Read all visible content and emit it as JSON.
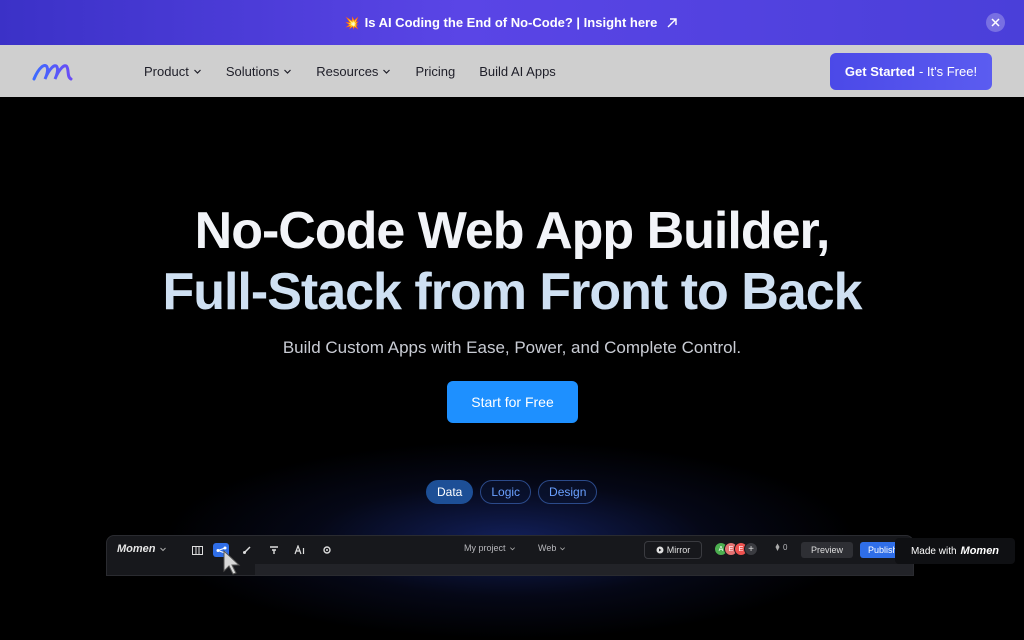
{
  "banner": {
    "emoji": "💥",
    "text": "Is AI Coding the End of No-Code? | Insight here"
  },
  "nav": {
    "items": [
      {
        "label": "Product",
        "dropdown": true
      },
      {
        "label": "Solutions",
        "dropdown": true
      },
      {
        "label": "Resources",
        "dropdown": true
      },
      {
        "label": "Pricing",
        "dropdown": false
      },
      {
        "label": "Build AI Apps",
        "dropdown": false
      }
    ],
    "cta_bold": "Get Started",
    "cta_rest": "- It's Free!"
  },
  "hero": {
    "title_line1": "No-Code Web App Builder,",
    "title_line2": "Full-Stack from Front to Back",
    "subtitle": "Build Custom Apps with Ease, Power, and Complete Control.",
    "cta": "Start for Free",
    "tabs": [
      "Data",
      "Logic",
      "Design"
    ],
    "active_tab": "Data"
  },
  "app_preview": {
    "logo": "Momen",
    "project": "My project",
    "platform": "Web",
    "mirror": "Mirror",
    "avatars": [
      {
        "letter": "A",
        "color": "#4caf50"
      },
      {
        "letter": "E",
        "color": "#e57373"
      },
      {
        "letter": "E",
        "color": "#ef5350"
      }
    ],
    "preview": "Preview",
    "publish": "Publish",
    "counter": "0"
  },
  "badge": {
    "prefix": "Made with",
    "brand": "Momen"
  },
  "colors": {
    "banner": "#4a3fd9",
    "cta_blue": "#1e90ff",
    "nav_bg": "#cfcfcf",
    "get_started": "#5053ec"
  }
}
